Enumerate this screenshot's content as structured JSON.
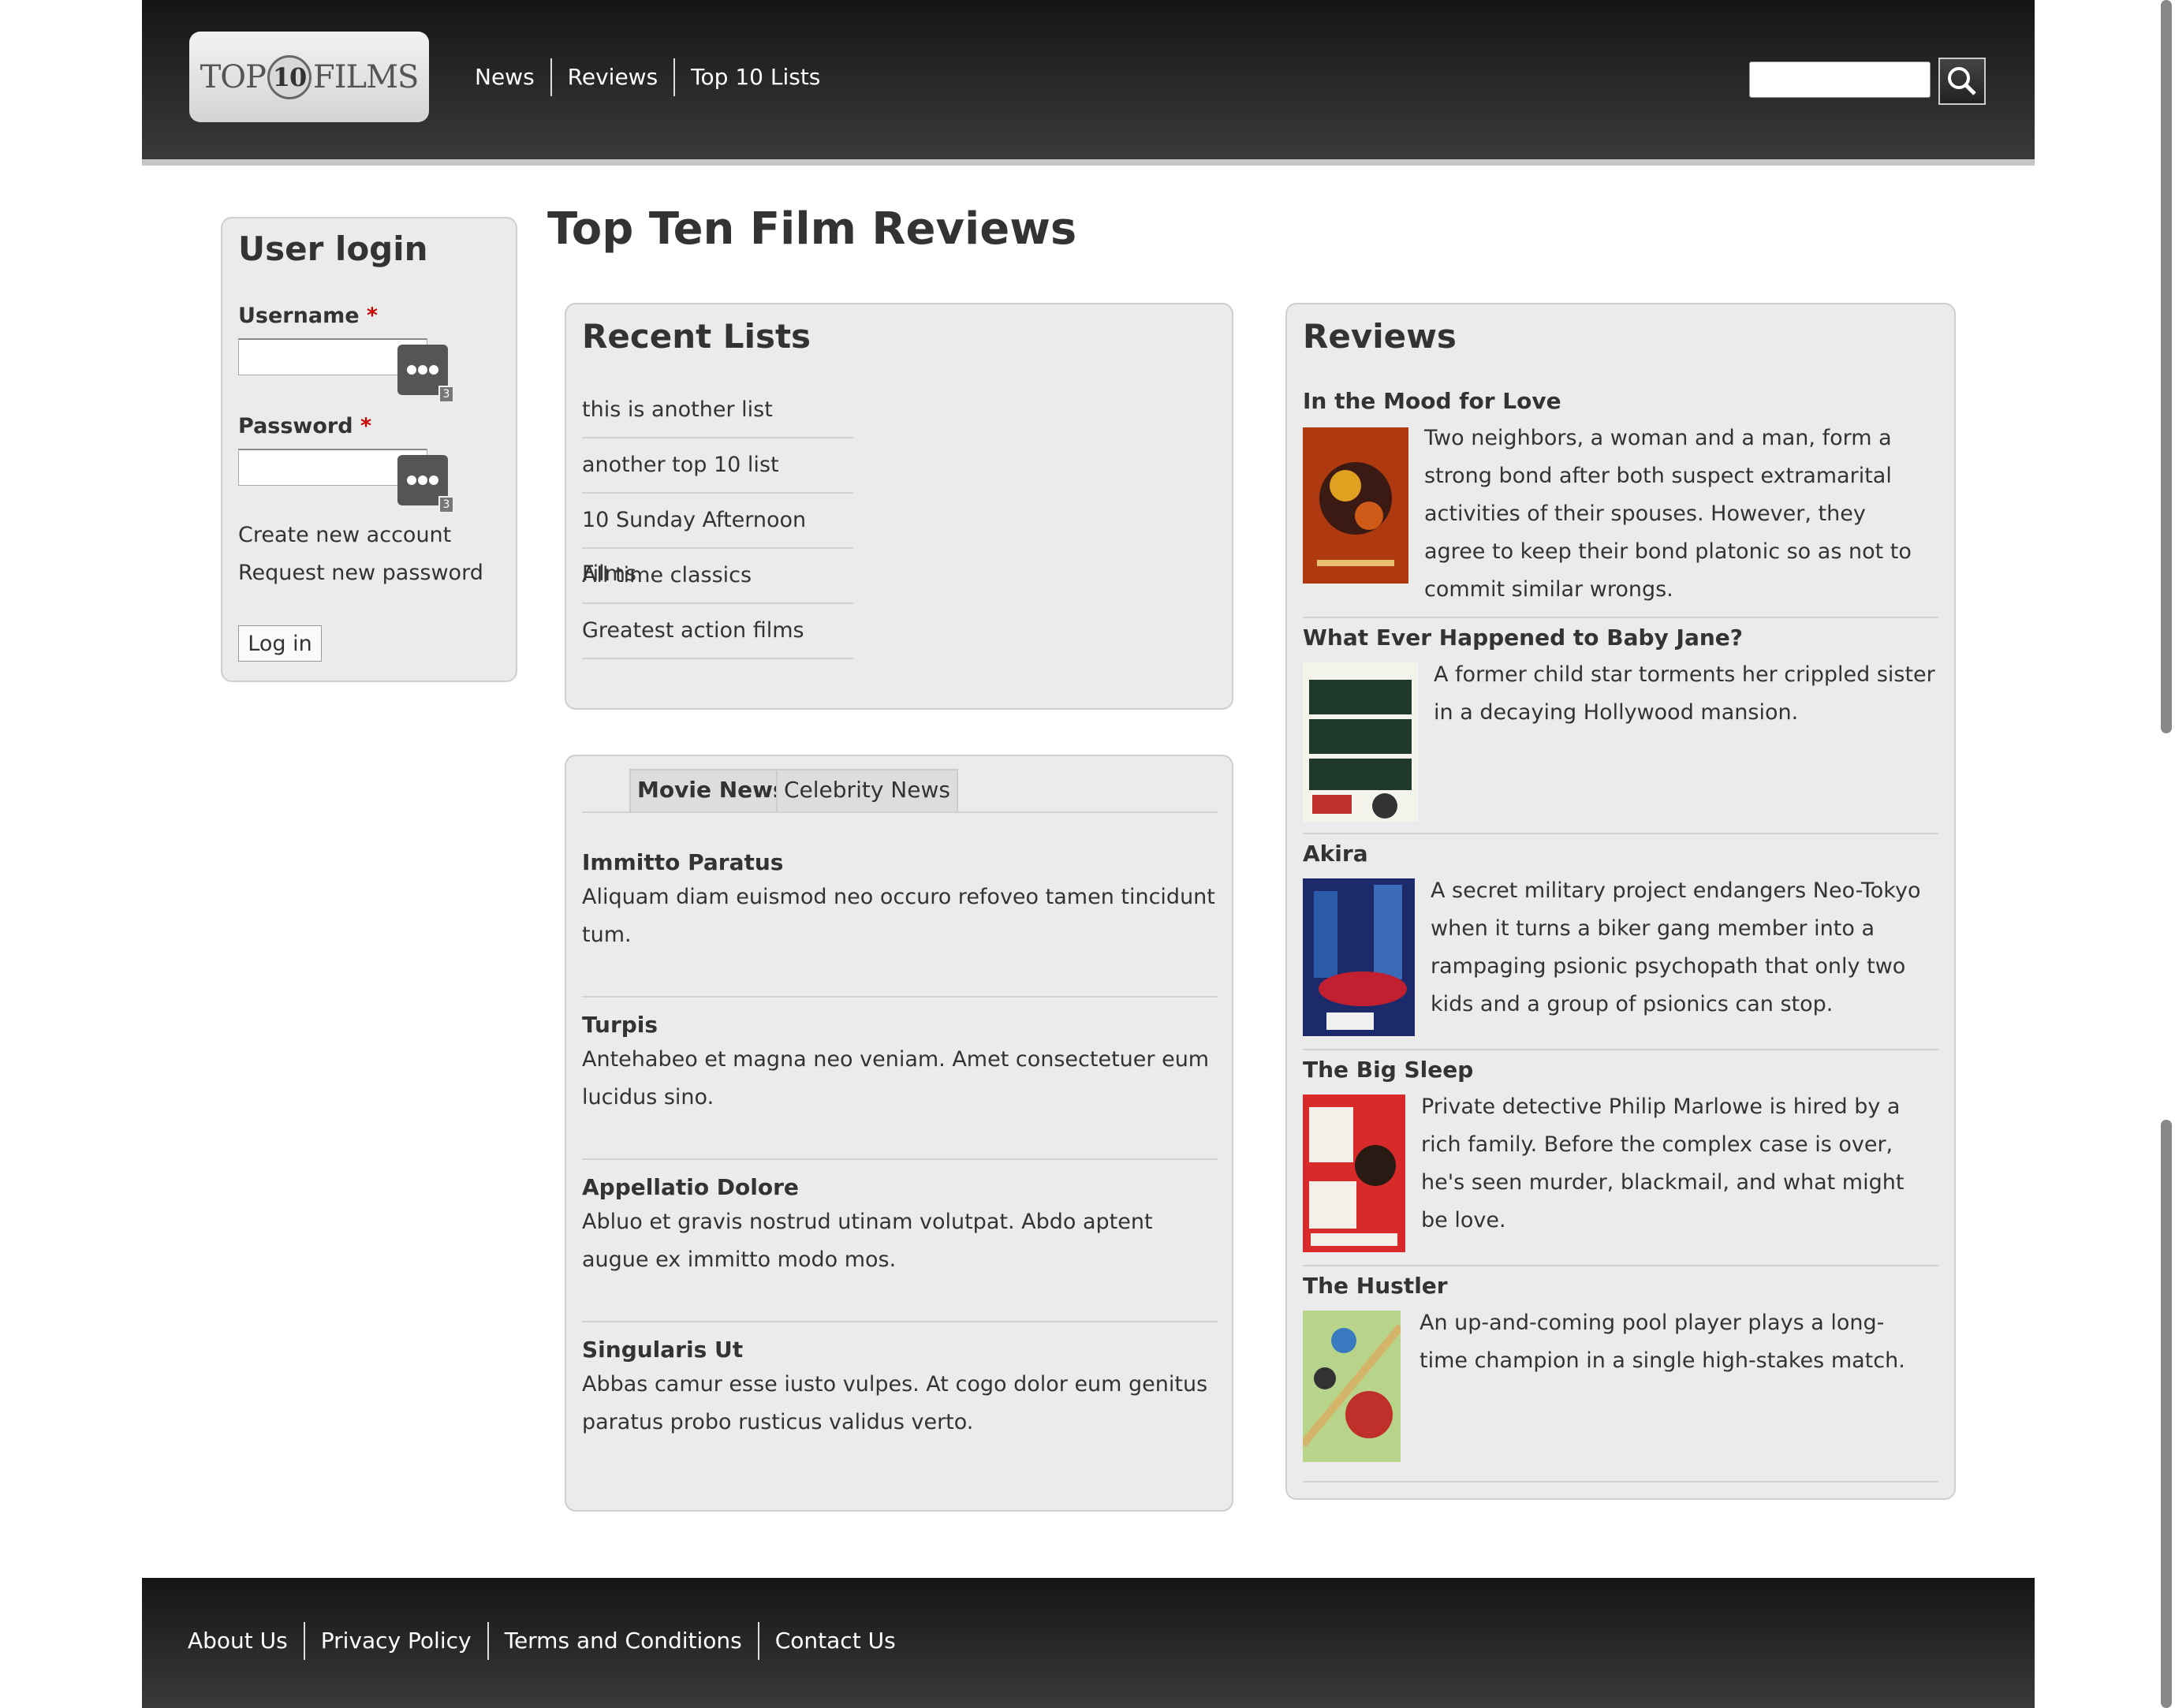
{
  "header": {
    "logo": {
      "top": "TOP",
      "ten": "10",
      "films": "FILMS"
    },
    "nav": [
      "News",
      "Reviews",
      "Top 10 Lists"
    ],
    "search_placeholder": ""
  },
  "login": {
    "title": "User login",
    "username_label": "Username",
    "password_label": "Password",
    "required_marker": "*",
    "badge": "3",
    "create_account": "Create new account",
    "request_password": "Request new password",
    "login_button": "Log in"
  },
  "page_title": "Top Ten Film Reviews",
  "recent_lists": {
    "title": "Recent Lists",
    "items": [
      "this is another list",
      "another top 10 list",
      "10 Sunday Afternoon Films",
      "All time classics",
      "Greatest action films"
    ]
  },
  "news": {
    "tabs": [
      "Movie News",
      "Celebrity News"
    ],
    "items": [
      {
        "title": "Immitto Paratus",
        "body": "Aliquam diam euismod neo occuro refoveo tamen tincidunt tum."
      },
      {
        "title": "Turpis",
        "body": "Antehabeo et magna neo veniam. Amet consectetuer eum lucidus sino."
      },
      {
        "title": "Appellatio Dolore",
        "body": "Abluo et gravis nostrud utinam volutpat. Abdo aptent augue ex immitto modo mos."
      },
      {
        "title": "Singularis Ut",
        "body": "Abbas camur esse iusto vulpes. At cogo dolor eum genitus paratus probo rusticus validus verto."
      }
    ]
  },
  "reviews": {
    "title": "Reviews",
    "items": [
      {
        "title": "In the Mood for Love",
        "description": "Two neighbors, a woman and a man, form a strong bond after both suspect extramarital activities of their spouses. However, they agree to keep their bond platonic so as not to commit similar wrongs."
      },
      {
        "title": "What Ever Happened to Baby Jane?",
        "description": "A former child star torments her crippled sister in a decaying Hollywood mansion."
      },
      {
        "title": "Akira",
        "description": "A secret military project endangers Neo-Tokyo when it turns a biker gang member into a rampaging psionic psychopath that only two kids and a group of psionics can stop."
      },
      {
        "title": "The Big Sleep",
        "description": "Private detective Philip Marlowe is hired by a rich family. Before the complex case is over, he's seen murder, blackmail, and what might be love."
      },
      {
        "title": "The Hustler",
        "description": "An up-and-coming pool player plays a long-time champion in a single high-stakes match."
      }
    ]
  },
  "footer": {
    "links": [
      "About Us",
      "Privacy Policy",
      "Terms and Conditions",
      "Contact Us"
    ]
  }
}
